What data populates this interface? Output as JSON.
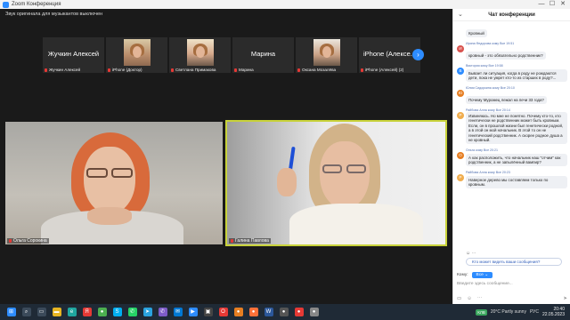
{
  "window": {
    "title": "Zoom Конференция",
    "controls": [
      "—",
      "☐",
      "✕"
    ]
  },
  "meeting": {
    "audio_note": "Звук оригинала для музыкантов выключен",
    "strip": [
      {
        "big_name": "Жучкин Алексей",
        "label": "Жучкин Алексей",
        "has_video": false
      },
      {
        "big_name": "",
        "label": "iPhone (Доктор)",
        "has_video": true
      },
      {
        "big_name": "",
        "label": "Светлана Примакова",
        "has_video": true
      },
      {
        "big_name": "Марина",
        "label": "Марина",
        "has_video": false
      },
      {
        "big_name": "",
        "label": "Оксана Мозалёва",
        "has_video": true
      },
      {
        "big_name": "iPhone (Алексе...",
        "label": "iPhone (Алексей) (2)",
        "has_video": false
      }
    ],
    "next_arrow": "›",
    "speaker_left_label": "Ольга Сорокина",
    "speaker_right_label": "Галина Павлова"
  },
  "chat": {
    "title": "Чат конференции",
    "collapse_icon": "⌄",
    "messages": [
      {
        "initial": "",
        "avatar_color": "#ffffff",
        "meta": "",
        "text": "Кровный"
      },
      {
        "initial": "И",
        "avatar_color": "#d9534f",
        "meta": "Ирина Федорова кому Все 19:51",
        "text": "кровный - это обязательно родственник?"
      },
      {
        "initial": "В",
        "avatar_color": "#2d8cff",
        "meta": "Виктория кому Все 19:58",
        "text": "Бывает ли ситуация, когда в роду не рождаются дети, пока не умрет кто-то из старших в роду?..."
      },
      {
        "initial": "Ю",
        "avatar_color": "#e67e22",
        "meta": "Юлия Сидоркина кому Все 20:10",
        "text": "Почему Муромец лежал на печи 33 года?"
      },
      {
        "initial": "Р",
        "avatar_color": "#f0ad4e",
        "meta": "Райбова Алла кому Все 20:14",
        "text": "Извиняюсь. Но мне не понятно. Почему кто-то, кто генетически не родственник может быть кровным. Если, он в прошлой жизни был генетически родной, а в этой он мой начальник. В этой то он не генетический родственник. А скорее родное душа а не кровный."
      },
      {
        "initial": "О",
        "avatar_color": "#e67e22",
        "meta": "Ольга кому Все 20:21",
        "text": "А как расположить, что начальник наш \"отчим\" как родственник, а не запылённый вампир?"
      },
      {
        "initial": "P",
        "avatar_color": "#f0ad4e",
        "meta": "Райбова Алла кому Все 20:23",
        "text": "Наверное дерево мы составляем только по кровным."
      }
    ],
    "msg_actions": "☺  ⋯",
    "reply_pill": "Кто может видеть ваши сообщения?",
    "to_label": "Кому:",
    "to_value": "Все ⌄",
    "input_placeholder": "Введите здесь сообщение...",
    "toolbar": [
      "▭",
      "☺",
      "⋯"
    ],
    "send_icon": "➤"
  },
  "taskbar": {
    "icons": [
      {
        "name": "start-icon",
        "glyph": "⊞",
        "color": "#2d8cff"
      },
      {
        "name": "search-icon",
        "glyph": "⌕",
        "color": "#3b4a5a"
      },
      {
        "name": "task-view-icon",
        "glyph": "▭",
        "color": "#3b4a5a"
      },
      {
        "name": "file-explorer-icon",
        "glyph": "▬",
        "color": "#e6b422"
      },
      {
        "name": "edge-icon",
        "glyph": "e",
        "color": "#1fa7a0"
      },
      {
        "name": "yandex-icon",
        "glyph": "Я",
        "color": "#e53935"
      },
      {
        "name": "chrome-icon",
        "glyph": "●",
        "color": "#4caf50"
      },
      {
        "name": "skype-icon",
        "glyph": "S",
        "color": "#00aff0"
      },
      {
        "name": "whatsapp-icon",
        "glyph": "✆",
        "color": "#25d366"
      },
      {
        "name": "telegram-icon",
        "glyph": "➤",
        "color": "#2aa3df"
      },
      {
        "name": "viber-icon",
        "glyph": "✆",
        "color": "#7d5cc7"
      },
      {
        "name": "mail-icon",
        "glyph": "✉",
        "color": "#0078d4"
      },
      {
        "name": "zoom-icon",
        "glyph": "▶",
        "color": "#2d8cff"
      },
      {
        "name": "photo-icon",
        "glyph": "▣",
        "color": "#444"
      },
      {
        "name": "opera-icon",
        "glyph": "O",
        "color": "#e53935"
      },
      {
        "name": "media-icon",
        "glyph": "●",
        "color": "#e67e22"
      },
      {
        "name": "firefox-icon",
        "glyph": "●",
        "color": "#ff7139"
      },
      {
        "name": "word-icon",
        "glyph": "W",
        "color": "#2b579a"
      },
      {
        "name": "app-icon",
        "glyph": "●",
        "color": "#555"
      },
      {
        "name": "browser-icon",
        "glyph": "●",
        "color": "#e53935"
      },
      {
        "name": "app2-icon",
        "glyph": "●",
        "color": "#888"
      }
    ],
    "badge": "КЛВ",
    "weather": "20°C  Partly sunny",
    "lang": "РУС",
    "time": "20:40",
    "date": "22.05.2023"
  }
}
